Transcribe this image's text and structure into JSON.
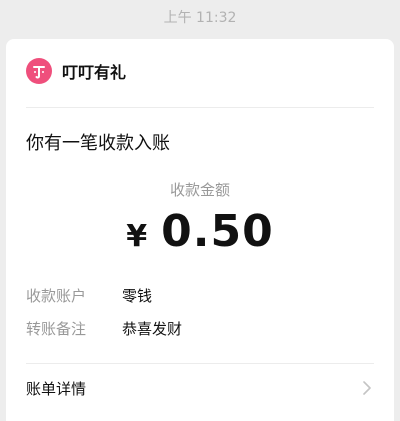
{
  "timestamp": "上午 11:32",
  "app": {
    "name": "叮叮有礼",
    "icon_glyph": "T",
    "icon_color": "#ef4f7c"
  },
  "notice": {
    "title": "你有一笔收款入账",
    "amount_label": "收款金额",
    "currency": "¥",
    "amount": "0.50"
  },
  "details": [
    {
      "key": "收款账户",
      "value": "零钱"
    },
    {
      "key": "转账备注",
      "value": "恭喜发财"
    }
  ],
  "footer": {
    "label": "账单详情"
  }
}
